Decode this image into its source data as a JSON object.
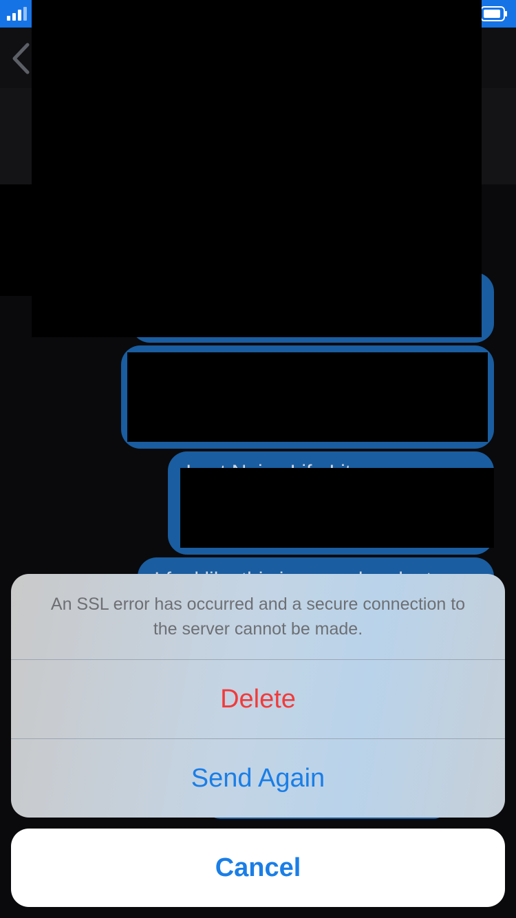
{
  "status_bar": {
    "signal_icon": "signal-bars-icon",
    "battery_icon": "battery-icon",
    "accent_color": "#1673e6"
  },
  "nav": {
    "back_icon": "chevron-left-icon"
  },
  "messages": [
    {
      "text": ""
    },
    {
      "text": ""
    },
    {
      "text": "I got Noise Life Lite..."
    },
    {
      "text": "I feel like this is a good gadget"
    }
  ],
  "action_sheet": {
    "message": "An SSL error has occurred and a secure connection to the server cannot be made.",
    "delete_label": "Delete",
    "send_again_label": "Send Again",
    "cancel_label": "Cancel",
    "destructive_color": "#f23a3a",
    "action_color": "#1a7ee6"
  }
}
